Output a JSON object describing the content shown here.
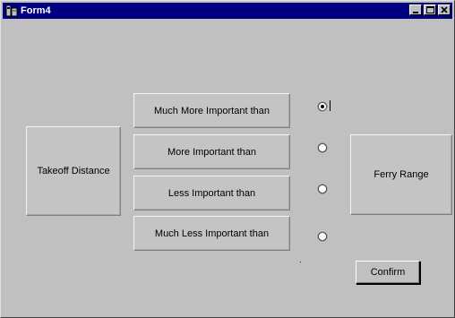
{
  "window": {
    "title": "Form4",
    "title_bar_color": "#000080",
    "app_icon": "app-icon",
    "controls": [
      "minimize-icon",
      "maximize-icon",
      "close-icon"
    ]
  },
  "form": {
    "left_item_label": "Takeoff Distance",
    "right_item_label": "Ferry Range",
    "comparisons": [
      {
        "label": "Much More Important than",
        "selected": true
      },
      {
        "label": "More Important than",
        "selected": false
      },
      {
        "label": "Less Important than",
        "selected": false
      },
      {
        "label": "Much Less Important than",
        "selected": false
      }
    ],
    "confirm_label": "Confirm"
  }
}
